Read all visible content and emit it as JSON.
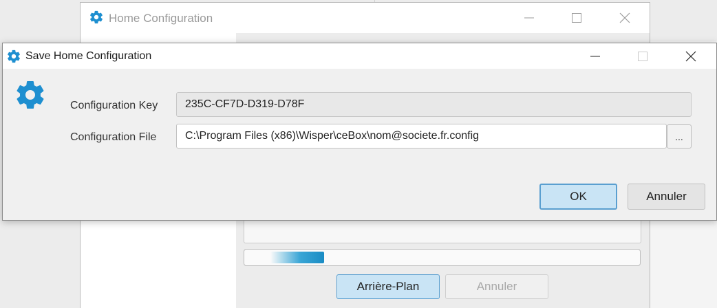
{
  "background_window": {
    "title": "Home Configuration",
    "progress": 0.2,
    "buttons": {
      "background_label": "Arrière-Plan",
      "cancel_label": "Annuler"
    }
  },
  "dialog": {
    "title": "Save Home Configuration",
    "fields": {
      "key_label": "Configuration Key",
      "key_value": "235C-CF7D-D319-D78F",
      "file_label": "Configuration File",
      "file_value": "C:\\Program Files (x86)\\Wisper\\ceBox\\nom@societe.fr.config",
      "browse_label": "..."
    },
    "buttons": {
      "ok_label": "OK",
      "cancel_label": "Annuler"
    }
  },
  "icons": {
    "app": "gear-icon",
    "minimize": "minimize-icon",
    "maximize": "maximize-icon",
    "close": "close-icon"
  },
  "colors": {
    "accent": "#1a8cc4",
    "primary_button": "#c9e4f5"
  }
}
